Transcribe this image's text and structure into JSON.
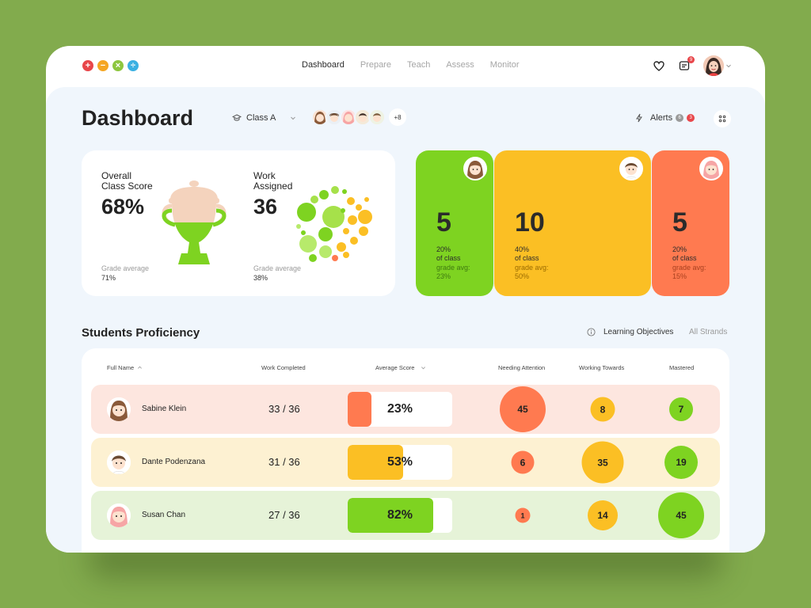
{
  "nav": {
    "items": [
      "Dashboard",
      "Prepare",
      "Teach",
      "Assess",
      "Monitor"
    ],
    "active": "Dashboard"
  },
  "notifications": {
    "count": "9"
  },
  "header": {
    "title": "Dashboard",
    "class_label": "Class A",
    "more_students": "+8",
    "alerts_label": "Alerts",
    "alerts_counts": [
      "6",
      "3"
    ]
  },
  "overall": {
    "label_line1": "Overall",
    "label_line2": "Class Score",
    "value": "68%",
    "sub_label": "Grade average",
    "sub_value": "71%",
    "fill_fraction": 0.68
  },
  "work": {
    "label_line1": "Work",
    "label_line2": "Assigned",
    "value": "36",
    "sub_label": "Grade average",
    "sub_value": "38%"
  },
  "groups": [
    {
      "count": "5",
      "pct_line1": "20%",
      "pct_line2": "of class",
      "gavg_label": "grade avg:",
      "gavg_value": "23%",
      "color": "#7ed321"
    },
    {
      "count": "10",
      "pct_line1": "40%",
      "pct_line2": "of class",
      "gavg_label": "grade avg:",
      "gavg_value": "50%",
      "color": "#fbbf24"
    },
    {
      "count": "5",
      "pct_line1": "20%",
      "pct_line2": "of class",
      "gavg_label": "grade avg:",
      "gavg_value": "15%",
      "color": "#ff7a50"
    }
  ],
  "proficiency": {
    "title": "Students Proficiency",
    "tab_objectives": "Learning Objectives",
    "tab_strands": "All Strands",
    "columns": [
      "Full Name",
      "Work Completed",
      "Average Score",
      "Needing Attention",
      "Working Towards",
      "Mastered"
    ],
    "rows": [
      {
        "name": "Sabine Klein",
        "work": "33 / 36",
        "score": "23%",
        "score_value": 23,
        "needing": "45",
        "towards": "8",
        "mastered": "7",
        "bg": "#fde6df",
        "fill": "#ff7a50"
      },
      {
        "name": "Dante Podenzana",
        "work": "31 / 36",
        "score": "53%",
        "score_value": 53,
        "needing": "6",
        "towards": "35",
        "mastered": "19",
        "bg": "#fdf1d2",
        "fill": "#fbbf24"
      },
      {
        "name": "Susan Chan",
        "work": "27 / 36",
        "score": "82%",
        "score_value": 82,
        "needing": "1",
        "towards": "14",
        "mastered": "45",
        "bg": "#e6f3d8",
        "fill": "#7ed321"
      }
    ]
  },
  "colors": {
    "red": "#ff7a50",
    "yellow": "#fbbf24",
    "green": "#7ed321",
    "accent_bg": "#f0f6fc"
  }
}
